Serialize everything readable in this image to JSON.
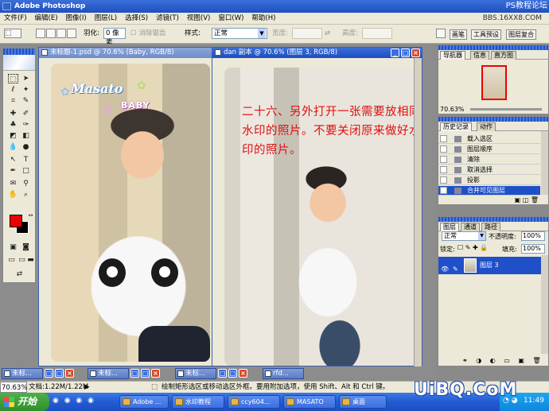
{
  "app": {
    "title": "Adobe Photoshop",
    "watermark_top": "PS教程论坛",
    "watermark_url": "BBS.16XX8.COM",
    "watermark_bottom": "UiBQ.CoM"
  },
  "menu": [
    "文件(F)",
    "编辑(E)",
    "图像(I)",
    "图层(L)",
    "选择(S)",
    "滤镜(T)",
    "视图(V)",
    "窗口(W)",
    "帮助(H)"
  ],
  "options": {
    "feather_label": "羽化:",
    "feather_value": "0 像素",
    "antialias_label": "消除锯齿",
    "style_label": "样式:",
    "style_value": "正常",
    "width_label": "宽度:",
    "height_label": "高度:",
    "palette_tabs": [
      "画笔",
      "工具预设",
      "图层复合"
    ]
  },
  "documents": [
    {
      "title": "未标题-1.psd @ 70.6% (Baby, RGB/8)"
    },
    {
      "title": "dan 副本 @ 70.6% (图层 3, RGB/8)"
    }
  ],
  "photo_logo": {
    "brand": "Masato",
    "sub": "BABY"
  },
  "instruction_text": "二十六、另外打开一张需要放相同水印的照片。不要关闭原来做好水印的照片。",
  "navigator": {
    "tabs": [
      "导航器",
      "信息",
      "直方图"
    ],
    "zoom": "70.63%"
  },
  "history": {
    "tabs": [
      "历史记录",
      "动作"
    ],
    "items": [
      "载入选区",
      "图层顺序",
      "清除",
      "取消选择",
      "投影",
      "合并可见图层"
    ]
  },
  "layers": {
    "tabs": [
      "图层",
      "通道",
      "路径"
    ],
    "blend_mode": "正常",
    "opacity_label": "不透明度:",
    "opacity_value": "100%",
    "lock_label": "锁定:",
    "fill_label": "填充:",
    "fill_value": "100%",
    "layer_name": "图层 3"
  },
  "doc_tabs": [
    "未标...",
    "未标...",
    "未标...",
    "rfd..."
  ],
  "status": {
    "zoom": "70.63%",
    "doc_size": "文档:1.22M/1.22M",
    "hint": "绘制矩形选区或移动选区外框。要用附加选项，使用 Shift、Alt 和 Ctrl 键。"
  },
  "taskbar": {
    "start": "开始",
    "tasks": [
      "Adobe ...",
      "水印教程",
      "ccy604...",
      "MASATO",
      "桌面"
    ],
    "clock": "11:49"
  },
  "colors": {
    "foreground": "#e00000",
    "background": "#000000",
    "instruction": "#e01010"
  }
}
